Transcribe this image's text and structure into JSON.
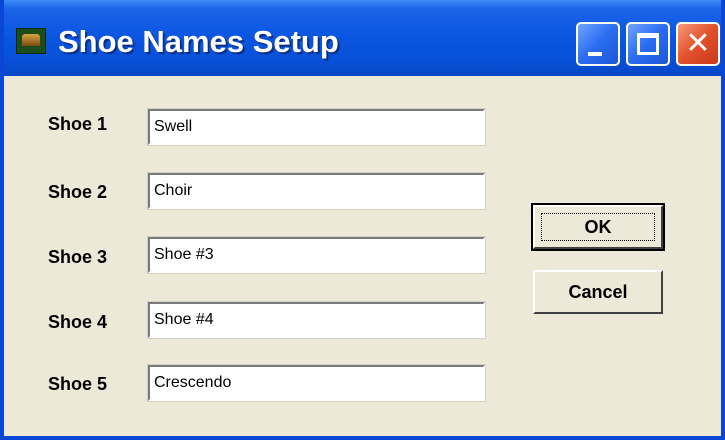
{
  "window": {
    "title": "Shoe Names Setup"
  },
  "titlebar_buttons": {
    "minimize_icon": "minimize-icon",
    "maximize_icon": "maximize-icon",
    "close_icon": "close-icon",
    "close_glyph": "✕"
  },
  "shoes": [
    {
      "label": "Shoe 1",
      "value": "Swell"
    },
    {
      "label": "Shoe 2",
      "value": "Choir"
    },
    {
      "label": "Shoe 3",
      "value": "Shoe #3"
    },
    {
      "label": "Shoe 4",
      "value": "Shoe #4"
    },
    {
      "label": "Shoe 5",
      "value": "Crescendo"
    }
  ],
  "buttons": {
    "ok_label": "OK",
    "cancel_label": "Cancel"
  },
  "colors": {
    "titlebar": "#0a55e0",
    "dialog_background": "#ece9d8",
    "close_button": "#e2512a"
  }
}
